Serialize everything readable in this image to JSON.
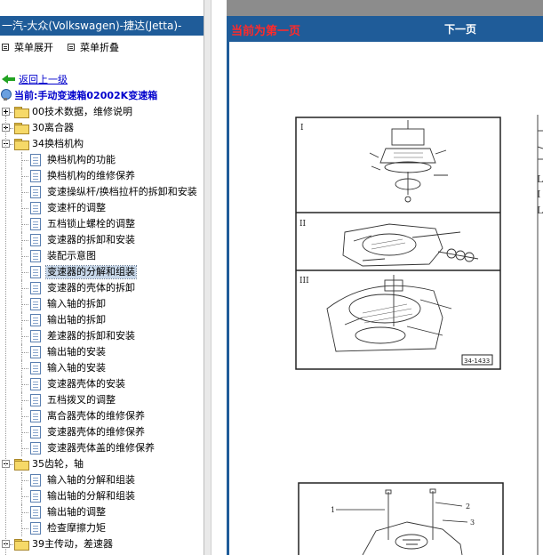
{
  "sidebar": {
    "title": "一汽-大众(Volkswagen)-捷达(Jetta)-",
    "expand_label": "菜单展开",
    "collapse_label": "菜单折叠",
    "back_label": "返回上一级",
    "current_label": "当前:手动变速箱02002K变速箱",
    "tree": [
      {
        "label": "00技术数据，维修说明",
        "type": "folder",
        "level": 0,
        "expanded": false
      },
      {
        "label": "30离合器",
        "type": "folder",
        "level": 0,
        "expanded": false
      },
      {
        "label": "34换档机构",
        "type": "folder",
        "level": 0,
        "expanded": true
      },
      {
        "label": "换档机构的功能",
        "type": "doc",
        "level": 1
      },
      {
        "label": "换档机构的维修保养",
        "type": "doc",
        "level": 1
      },
      {
        "label": "变速操纵杆/换档拉杆的拆卸和安装",
        "type": "doc",
        "level": 1
      },
      {
        "label": "变速杆的调整",
        "type": "doc",
        "level": 1
      },
      {
        "label": "五档锁止螺栓的调整",
        "type": "doc",
        "level": 1
      },
      {
        "label": "变速器的拆卸和安装",
        "type": "doc",
        "level": 1
      },
      {
        "label": "装配示意图",
        "type": "doc",
        "level": 1
      },
      {
        "label": "变速器的分解和组装",
        "type": "doc",
        "level": 1,
        "selected": true
      },
      {
        "label": "变速器的壳体的拆卸",
        "type": "doc",
        "level": 1
      },
      {
        "label": "输入轴的拆卸",
        "type": "doc",
        "level": 1
      },
      {
        "label": "输出轴的拆卸",
        "type": "doc",
        "level": 1
      },
      {
        "label": "差速器的拆卸和安装",
        "type": "doc",
        "level": 1
      },
      {
        "label": "输出轴的安装",
        "type": "doc",
        "level": 1
      },
      {
        "label": "输入轴的安装",
        "type": "doc",
        "level": 1
      },
      {
        "label": "变速器壳体的安装",
        "type": "doc",
        "level": 1
      },
      {
        "label": "五档拨叉的调整",
        "type": "doc",
        "level": 1
      },
      {
        "label": "离合器壳体的维修保养",
        "type": "doc",
        "level": 1
      },
      {
        "label": "变速器壳体的维修保养",
        "type": "doc",
        "level": 1
      },
      {
        "label": "变速器壳体盖的维修保养",
        "type": "doc",
        "level": 1
      },
      {
        "label": "35齿轮，轴",
        "type": "folder",
        "level": 0,
        "expanded": true
      },
      {
        "label": "输入轴的分解和组装",
        "type": "doc",
        "level": 1
      },
      {
        "label": "输出轴的分解和组装",
        "type": "doc",
        "level": 1
      },
      {
        "label": "输出轴的调整",
        "type": "doc",
        "level": 1
      },
      {
        "label": "检查摩擦力矩",
        "type": "doc",
        "level": 1
      },
      {
        "label": "39主传动，差速器",
        "type": "folder",
        "level": 0,
        "expanded": true
      }
    ]
  },
  "content": {
    "page_status": "当前为第一页",
    "next_page_label": "下一页",
    "figure_1": {
      "panel_labels": [
        "I",
        "II",
        "III"
      ],
      "figure_number": "34-1433"
    },
    "figure_2": {
      "callouts": [
        "1",
        "2",
        "3"
      ]
    }
  },
  "colors": {
    "header_blue": "#1f5c99",
    "page_status_red": "#ff2a2a",
    "link_blue": "#0000cc",
    "selection": "#c8d8ea"
  }
}
